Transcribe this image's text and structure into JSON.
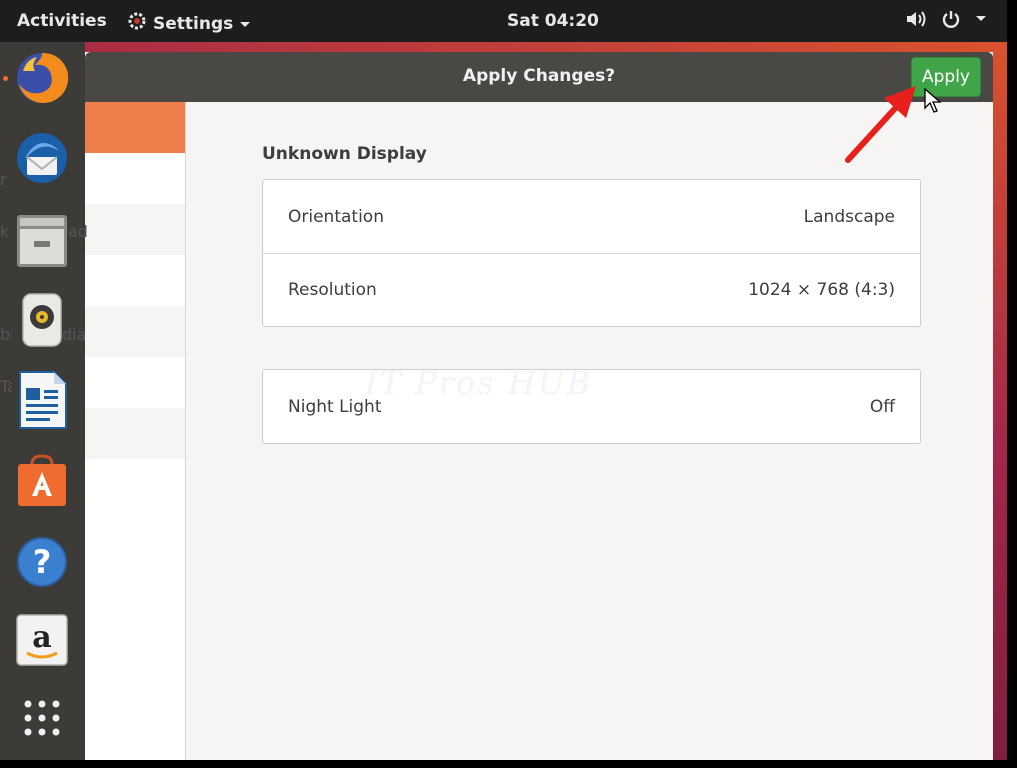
{
  "topbar": {
    "activities": "Activities",
    "app_menu": "Settings",
    "clock": "Sat 04:20"
  },
  "dock": {
    "items": [
      {
        "icon": "firefox-icon"
      },
      {
        "icon": "thunderbird-icon"
      },
      {
        "icon": "files-icon"
      },
      {
        "icon": "rhythmbox-icon"
      },
      {
        "icon": "libreoffice-writer-icon"
      },
      {
        "icon": "ubuntu-software-icon"
      },
      {
        "icon": "help-icon"
      },
      {
        "icon": "amazon-icon"
      },
      {
        "icon": "show-applications-icon"
      }
    ]
  },
  "window": {
    "title": "Apply Changes?",
    "apply_label": "Apply"
  },
  "sidebar": {
    "partial_labels": [
      "rd",
      "k T",
      "ad",
      "ble",
      "dia",
      "Ta"
    ]
  },
  "display": {
    "name": "Unknown Display",
    "rows": [
      {
        "label": "Orientation",
        "value": "Landscape"
      },
      {
        "label": "Resolution",
        "value": "1024 × 768 (4:3)"
      }
    ],
    "night_light": {
      "label": "Night Light",
      "value": "Off"
    }
  },
  "watermark": "IT Pros HUB",
  "colors": {
    "accent_orange": "#ef7e4d",
    "apply_green": "#40a548",
    "headerbar": "#4a4844",
    "dock": "#3c3b37",
    "annotation_arrow": "#e8201c"
  }
}
